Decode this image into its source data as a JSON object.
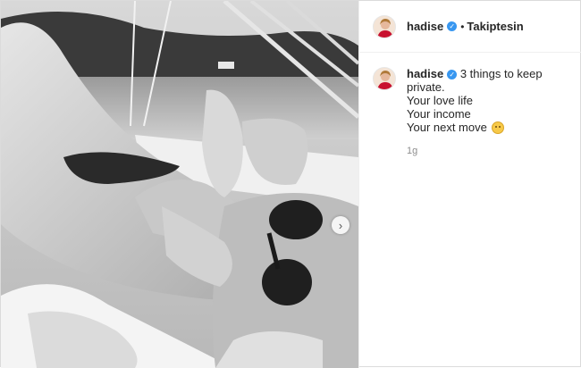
{
  "post": {
    "author": {
      "username": "hadise",
      "verified_mark": "✓",
      "follow_status": "Takiptesin",
      "separator": "•",
      "avatar_icon": "profile-avatar"
    },
    "caption": {
      "username": "hadise",
      "lines": [
        "3 things to keep private.",
        "Your love life",
        "Your income",
        "Your next move"
      ],
      "emoji": "smiling-face-emoji",
      "timestamp": "1g"
    },
    "media": {
      "description_icon": "photo-black-and-white",
      "next_arrow": "›"
    }
  },
  "colors": {
    "verified_blue": "#3897f0",
    "text": "#262626",
    "muted": "#8e8e8e",
    "border": "#dbdbdb"
  }
}
